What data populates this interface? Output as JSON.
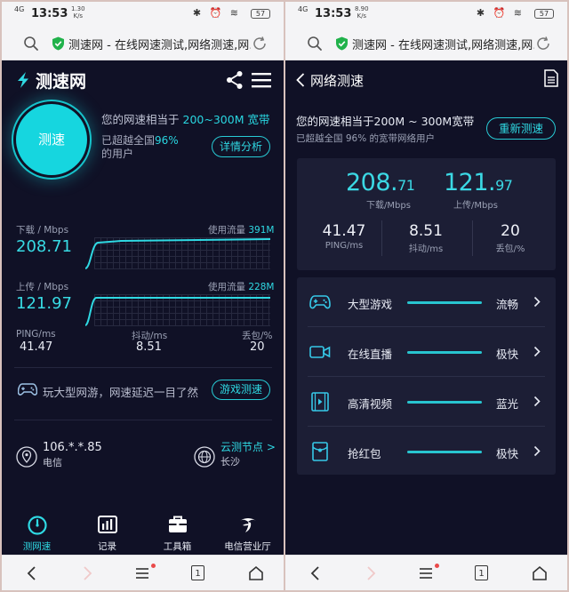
{
  "status_left": {
    "network": "4G",
    "time": "13:53",
    "speed_value": "1.30",
    "speed_unit": "K/s",
    "icons": "✱ ⏰ ≋",
    "battery": "57"
  },
  "status_right": {
    "network": "4G",
    "time": "13:53",
    "speed_value": "8.90",
    "speed_unit": "K/s",
    "icons": "✱ ⏰ ≋",
    "battery": "57"
  },
  "url_text": "测速网 - 在线网速测试,网络测速,网…",
  "url_text_right": "测速网 - 在线网速测试,网络测速,网…",
  "left": {
    "brand": "测速网",
    "gauge_label": "测速",
    "equiv_prefix": "您的网速相当于",
    "equiv_value": "200~300M 宽带",
    "beat_prefix": "已超越全国",
    "beat_value": "96%",
    "beat_suffix": "的用户",
    "detail_button": "详情分析",
    "download_label": "下载 / Mbps",
    "download_value": "208.71",
    "download_usage_label": "使用流量",
    "download_usage_value": "391M",
    "upload_label": "上传 / Mbps",
    "upload_value": "121.97",
    "upload_usage_label": "使用流量",
    "upload_usage_value": "228M",
    "ping_label": "PING/ms",
    "ping_value": "41.47",
    "jitter_label": "抖动/ms",
    "jitter_value": "8.51",
    "loss_label": "丢包/%",
    "loss_value": "20",
    "game_text": "玩大型网游，网速延迟一目了然",
    "game_button": "游戏测速",
    "ip": "106.*.*.85",
    "isp": "电信",
    "node_link": "云测节点 >",
    "city": "长沙",
    "tabs": [
      {
        "label": "测网速"
      },
      {
        "label": "记录"
      },
      {
        "label": "工具箱"
      },
      {
        "label": "电信营业厅"
      }
    ]
  },
  "right": {
    "title": "网络测速",
    "equiv_text": "您的网速相当于200M ~ 300M宽带",
    "beat_text": "已超越全国 96% 的宽带网络用户",
    "retest_button": "重新测速",
    "download_int": "208.",
    "download_dec": "71",
    "download_label": "下载/Mbps",
    "upload_int": "121.",
    "upload_dec": "97",
    "upload_label": "上传/Mbps",
    "ping_value": "41.47",
    "ping_label": "PING/ms",
    "jitter_value": "8.51",
    "jitter_label": "抖动/ms",
    "loss_value": "20",
    "loss_label": "丢包/%",
    "rows": [
      {
        "name": "大型游戏",
        "value": "流畅"
      },
      {
        "name": "在线直播",
        "value": "极快"
      },
      {
        "name": "高清视频",
        "value": "蓝光"
      },
      {
        "name": "抢红包",
        "value": "极快"
      }
    ]
  },
  "nav_tab_count": "1",
  "colors": {
    "accent": "#2fd9e3",
    "background": "#101126",
    "panel": "#1c1e35"
  }
}
